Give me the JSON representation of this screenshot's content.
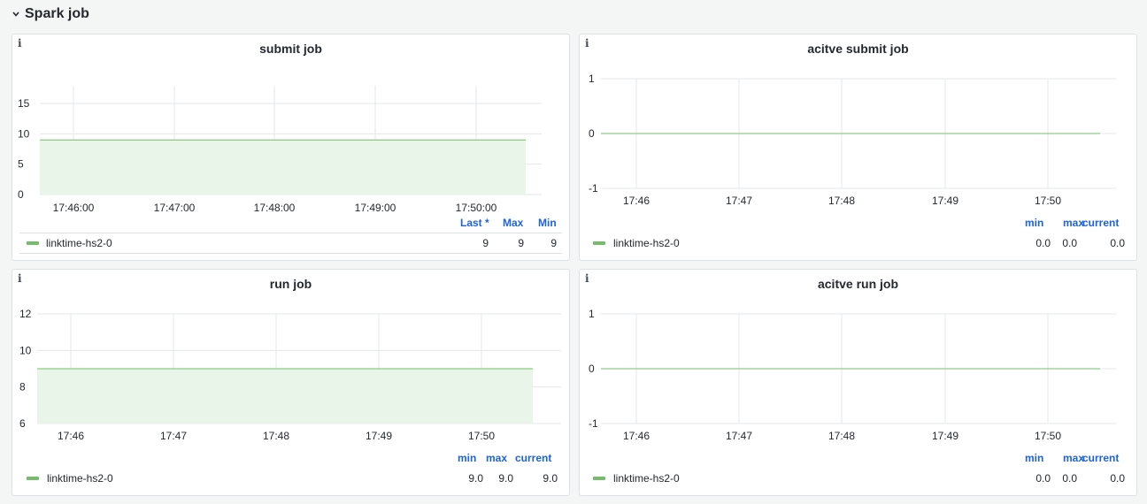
{
  "row": {
    "title": "Spark job",
    "chevron": "chevron-down-icon"
  },
  "colors": {
    "series": "#73bf69",
    "fill": "#e9f5e8",
    "grid": "#e4e7ea",
    "legend_header": "#1f62e0",
    "panel_bg": "#ffffff",
    "page_bg": "#f4f5f5"
  },
  "panels": [
    {
      "title": "submit job",
      "info_icon": "info-icon",
      "chart_data": {
        "type": "area",
        "x": [
          "17:46:00",
          "17:47:00",
          "17:48:00",
          "17:49:00",
          "17:50:00"
        ],
        "series": [
          {
            "name": "linktime-hs2-0",
            "values": [
              9,
              9,
              9,
              9,
              9
            ]
          }
        ],
        "y_ticks": [
          "15",
          "10",
          "5",
          "0"
        ],
        "ylim": [
          0,
          18
        ]
      },
      "legend": {
        "headers": [
          "Last *",
          "Max",
          "Min"
        ],
        "rows": [
          {
            "name": "linktime-hs2-0",
            "values": [
              "9",
              "9",
              "9"
            ]
          }
        ]
      }
    },
    {
      "title": "acitve submit job",
      "info_icon": "info-icon",
      "chart_data": {
        "type": "line",
        "x": [
          "17:46",
          "17:47",
          "17:48",
          "17:49",
          "17:50"
        ],
        "series": [
          {
            "name": "linktime-hs2-0",
            "values": [
              0,
              0,
              0,
              0,
              0
            ]
          }
        ],
        "y_ticks": [
          "1",
          "0",
          "-1"
        ],
        "ylim": [
          -1,
          1
        ]
      },
      "legend": {
        "headers": [
          "min",
          "max",
          "current"
        ],
        "rows": [
          {
            "name": "linktime-hs2-0",
            "values": [
              "0.0",
              "0.0",
              "0.0"
            ]
          }
        ]
      }
    },
    {
      "title": "run job",
      "info_icon": "info-icon",
      "chart_data": {
        "type": "area",
        "x": [
          "17:46",
          "17:47",
          "17:48",
          "17:49",
          "17:50"
        ],
        "series": [
          {
            "name": "linktime-hs2-0",
            "values": [
              9,
              9,
              9,
              9,
              9
            ]
          }
        ],
        "y_ticks": [
          "12",
          "10",
          "8",
          "6"
        ],
        "ylim": [
          6,
          12
        ]
      },
      "legend": {
        "headers": [
          "min",
          "max",
          "current"
        ],
        "rows": [
          {
            "name": "linktime-hs2-0",
            "values": [
              "9.0",
              "9.0",
              "9.0"
            ]
          }
        ]
      }
    },
    {
      "title": "acitve run job",
      "info_icon": "info-icon",
      "chart_data": {
        "type": "line",
        "x": [
          "17:46",
          "17:47",
          "17:48",
          "17:49",
          "17:50"
        ],
        "series": [
          {
            "name": "linktime-hs2-0",
            "values": [
              0,
              0,
              0,
              0,
              0
            ]
          }
        ],
        "y_ticks": [
          "1",
          "0",
          "-1"
        ],
        "ylim": [
          -1,
          1
        ]
      },
      "legend": {
        "headers": [
          "min",
          "max",
          "current"
        ],
        "rows": [
          {
            "name": "linktime-hs2-0",
            "values": [
              "0.0",
              "0.0",
              "0.0"
            ]
          }
        ]
      }
    }
  ]
}
